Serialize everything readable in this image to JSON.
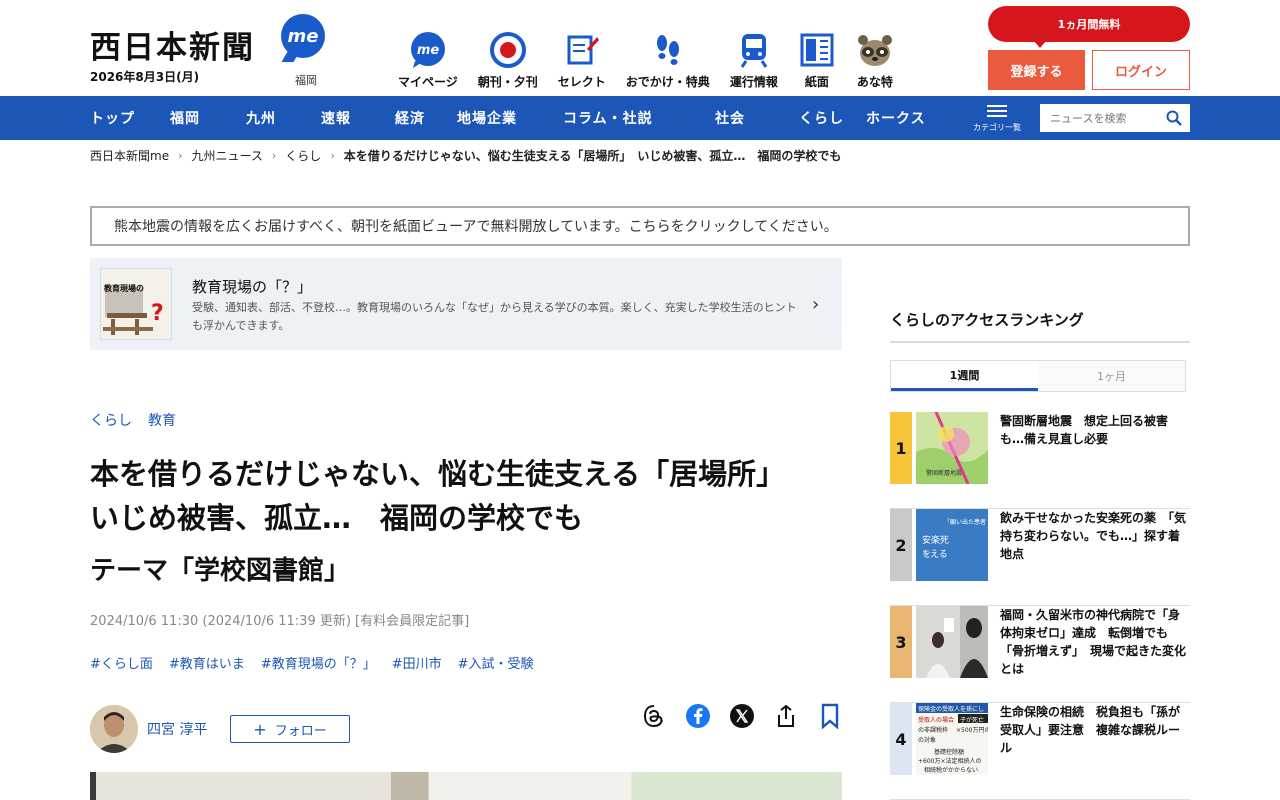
{
  "header": {
    "logo": "西日本新聞",
    "me_badge": "me",
    "date": "2026年8月3日(月)",
    "region": "福岡",
    "nav_icons": [
      {
        "label": "マイページ",
        "icon": "me-icon"
      },
      {
        "label": "朝刊・夕刊",
        "icon": "newspaper-icon"
      },
      {
        "label": "セレクト",
        "icon": "select-icon"
      },
      {
        "label": "おでかけ・特典",
        "icon": "footprints-icon"
      },
      {
        "label": "運行情報",
        "icon": "train-icon"
      },
      {
        "label": "紙面",
        "icon": "paper-icon"
      },
      {
        "label": "あな特",
        "icon": "tanuki-icon"
      }
    ],
    "promo": "1ヵ月間無料",
    "register": "登録する",
    "login": "ログイン"
  },
  "navbar": {
    "items": [
      "トップ",
      "福岡",
      "九州",
      "速報",
      "経済",
      "地場企業",
      "コラム・社説",
      "社会",
      "くらし",
      "ホークス"
    ],
    "category_label": "カテゴリ一覧",
    "search_placeholder": "ニュースを検索"
  },
  "breadcrumb": {
    "items": [
      "西日本新聞me",
      "九州ニュース",
      "くらし"
    ],
    "current": "本を借りるだけじゃない、悩む生徒支える「居場所」　いじめ被害、孤立…　福岡の学校でも"
  },
  "notice": "熊本地震の情報を広くお届けすべく、朝刊を紙面ビューアで無料開放しています。こちらをクリックしてください。",
  "series": {
    "thumb_text": "教育現場の",
    "thumb_mark": "?",
    "title": "教育現場の「？」",
    "description": "受験、通知表、部活、不登校…。教育現場のいろんな「なぜ」から見える学びの本質。楽しく、充実した学校生活のヒントも浮かんできます。"
  },
  "article": {
    "categories": [
      "くらし",
      "教育"
    ],
    "headline_line1": "本を借りるだけじゃない、悩む生徒支える「居場所」",
    "headline_line2": "いじめ被害、孤立…　福岡の学校でも",
    "subhead": "テーマ「学校図書館」",
    "meta": "2024/10/6 11:30 (2024/10/6 11:39 更新) [有料会員限定記事]",
    "hashtags": [
      "#くらし面",
      "#教育はいま",
      "#教育現場の「？」",
      "#田川市",
      "#入試・受験"
    ],
    "author": "四宮 淳平",
    "follow": "フォロー",
    "follow_plus": "+"
  },
  "ranking": {
    "title": "くらしのアクセスランキング",
    "tabs": [
      "1週間",
      "1ヶ月"
    ],
    "items": [
      {
        "rank": "1",
        "text": "警固断層地震　想定上回る被害も…備え見直し必要",
        "color": "#f6c53a"
      },
      {
        "rank": "2",
        "text": "飲み干せなかった安楽死の薬　「気持ち変わらない。でも…」探す着地点",
        "color": "#c9c9c9"
      },
      {
        "rank": "3",
        "text": "福岡・久留米市の神代病院で「身体拘束ゼロ」達成　転倒増でも「骨折増えず」　現場で起きた変化とは",
        "color": "#e9b671"
      },
      {
        "rank": "4",
        "text": "生命保険の相続　税負担も「孫が受取人」要注意　複雑な課税ルール",
        "color": "#dce6f3"
      }
    ]
  },
  "thumb_text": {
    "rank1": "警固断層地震",
    "rank2_a": "「願い出た患者",
    "rank2_b": "安楽死",
    "rank2_c": "を",
    "rank2_d": "える",
    "rank4_a": "保険金の受取人を孫にし",
    "rank4_b": "受取人の場合",
    "rank4_c": "子が死亡",
    "rank4_d": "の非課税枠",
    "rank4_e": "×500万円の",
    "rank4_f": "の対象",
    "rank4_g": "基礎控除額",
    "rank4_h": "+600万×法定相続人の",
    "rank4_i": "相続税がかからない"
  },
  "colors": {
    "brand_blue": "#1c56b6",
    "promo_red": "#d5161d",
    "register_orange": "#ea5a3e"
  }
}
